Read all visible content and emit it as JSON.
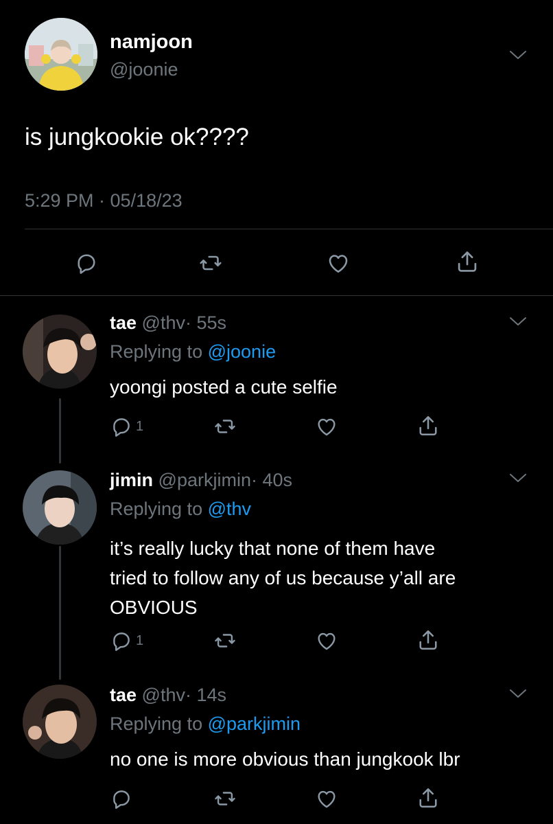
{
  "main_tweet": {
    "display_name": "namjoon",
    "handle": "@joonie",
    "text": "is jungkookie ok????",
    "timestamp": "5:29 PM · 05/18/23"
  },
  "replies": [
    {
      "display_name": "tae",
      "handle": "@thv",
      "time": "· 55s",
      "replying_prefix": "Replying to",
      "replying_to": "@joonie",
      "text": "yoongi posted a cute selfie",
      "reply_count": "1"
    },
    {
      "display_name": "jimin",
      "handle": "@parkjimin",
      "time": "· 40s",
      "replying_prefix": "Replying to",
      "replying_to": "@thv",
      "text_lines": [
        "it’s really lucky that none of them have",
        "tried to follow any of us because y’all are",
        "OBVIOUS"
      ],
      "reply_count": "1"
    },
    {
      "display_name": "tae",
      "handle": "@thv",
      "time": "· 14s",
      "replying_prefix": "Replying to",
      "replying_to": "@parkjimin",
      "text": "no one is more obvious than jungkook lbr",
      "reply_count": ""
    }
  ],
  "icons": [
    "chevron-down-icon",
    "reply-icon",
    "retweet-icon",
    "like-icon",
    "share-icon"
  ],
  "colors": {
    "background": "#000000",
    "text": "#e7e9ea",
    "secondary": "#6e767d",
    "link": "#1d9bf0",
    "divider": "#2f3336"
  }
}
